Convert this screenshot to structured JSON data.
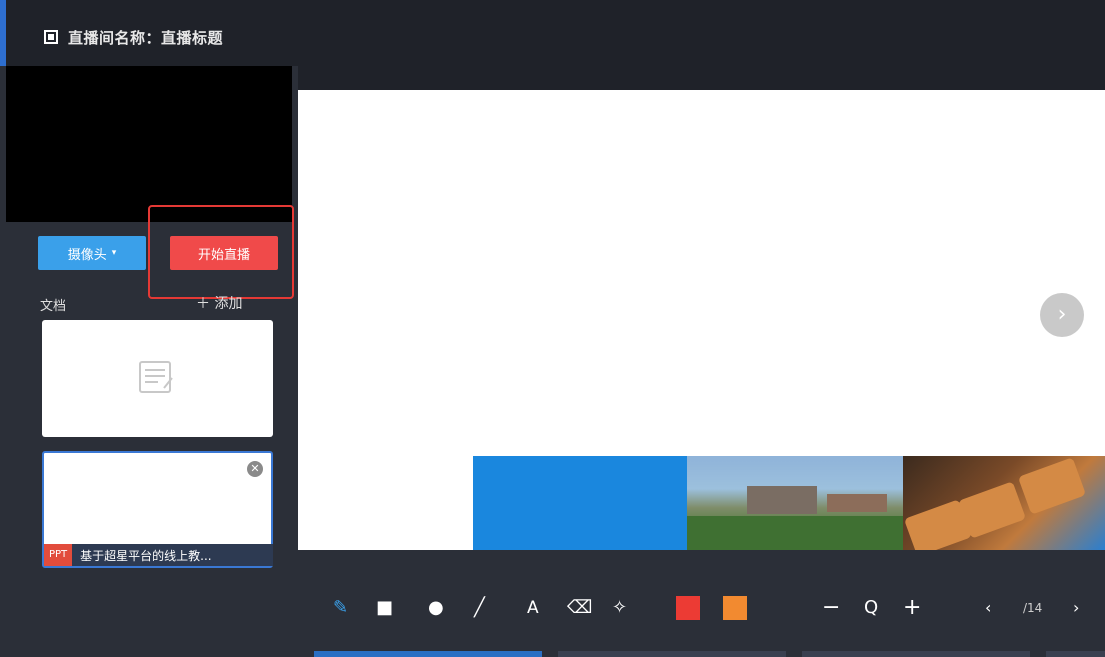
{
  "window": {
    "title": "直播间名称：直播标题"
  },
  "sidebar": {
    "camera_button": {
      "label": "摄像头",
      "icon": "caret-down-icon"
    },
    "start_button": {
      "label": "开始直播"
    },
    "docs_label": "文档",
    "add_button": {
      "label": "＋ 添加"
    },
    "docs": [
      {
        "type": "placeholder",
        "icon": "document-icon"
      },
      {
        "type": "ppt",
        "badge": "PPT",
        "name": "基于超星平台的线上教...",
        "close_icon": "close-icon"
      }
    ]
  },
  "slide": {
    "next_icon": "chevron-right-icon"
  },
  "toolbar": {
    "tools": [
      {
        "name": "pen",
        "icon": "pen-icon"
      },
      {
        "name": "rectangle",
        "icon": "rectangle-icon"
      },
      {
        "name": "circle",
        "icon": "circle-icon"
      },
      {
        "name": "line",
        "icon": "line-icon"
      },
      {
        "name": "text",
        "icon": "text-icon"
      },
      {
        "name": "eraser",
        "icon": "eraser-icon"
      },
      {
        "name": "clear",
        "icon": "broom-icon"
      }
    ],
    "colors": [
      "#ec3b34",
      "#f28a30"
    ],
    "zoom_out": "−",
    "zoom": "Q",
    "zoom_in": "+",
    "prev": "‹",
    "page": "/14",
    "next": "›"
  }
}
